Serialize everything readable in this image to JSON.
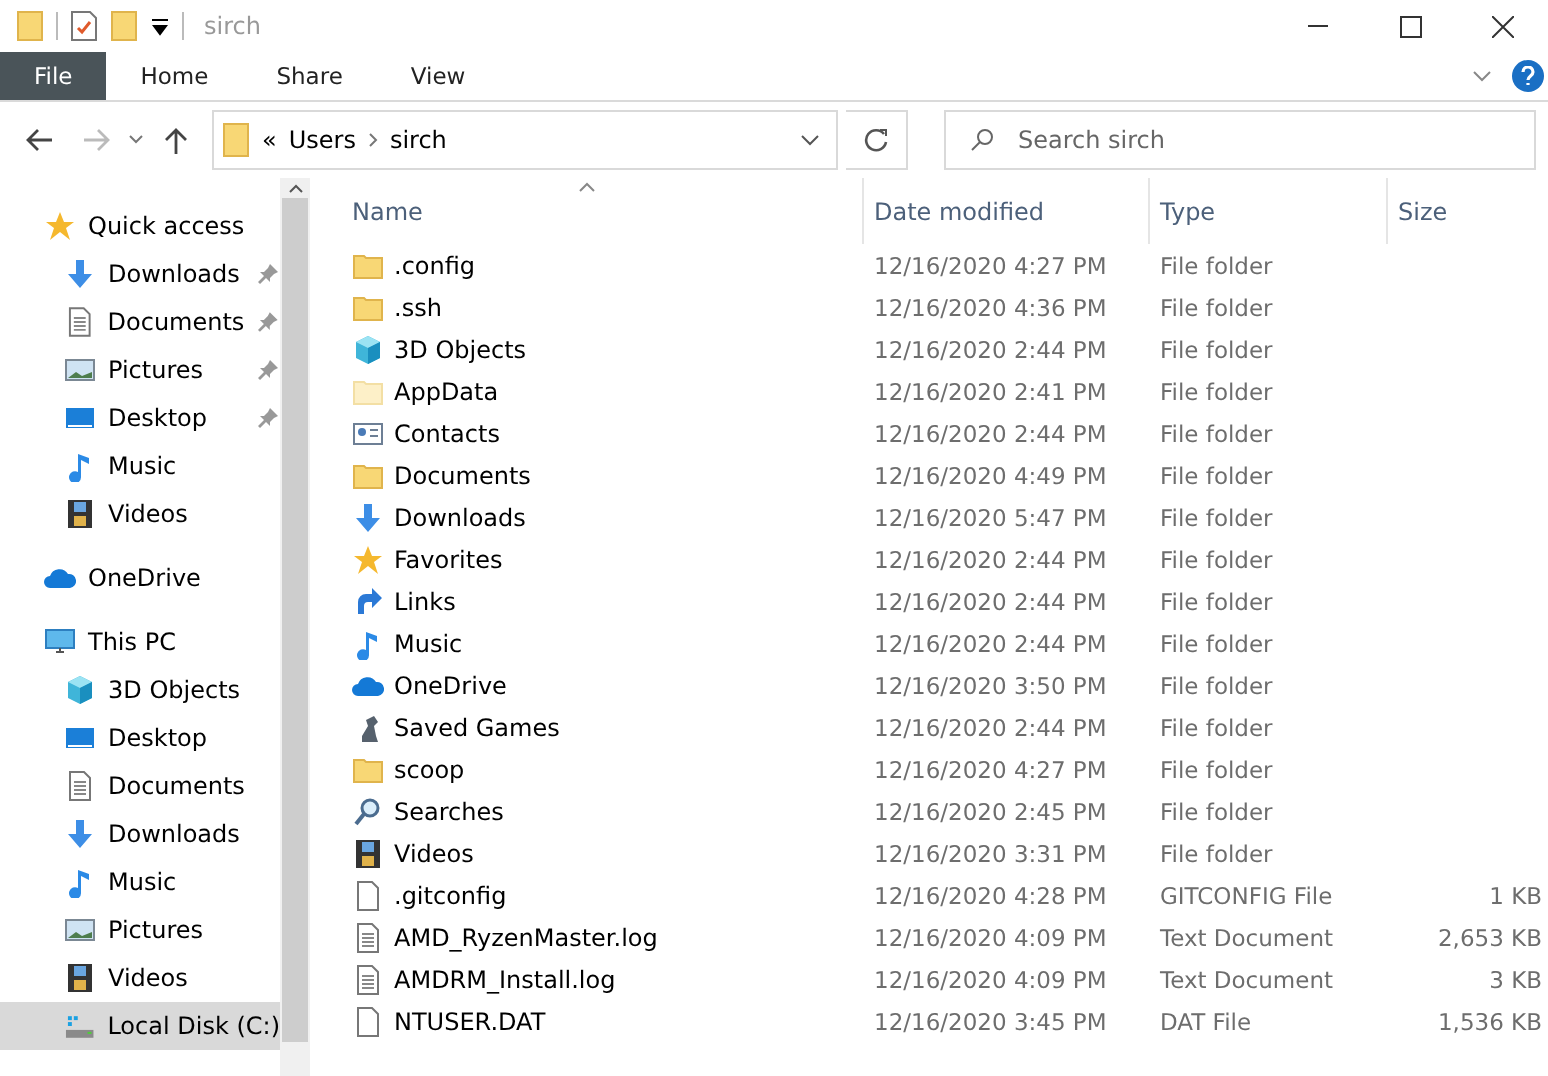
{
  "window": {
    "title": "sirch"
  },
  "ribbon_tabs": [
    {
      "label": "File",
      "selected": true
    },
    {
      "label": "Home",
      "selected": false
    },
    {
      "label": "Share",
      "selected": false
    },
    {
      "label": "View",
      "selected": false
    }
  ],
  "address": {
    "overflow": "«",
    "path": [
      "Users",
      "sirch"
    ]
  },
  "search": {
    "placeholder": "Search sirch"
  },
  "sidebar": {
    "items": [
      {
        "label": "Quick access",
        "kind": "star",
        "selected": false,
        "pinned": false,
        "children": [
          {
            "label": "Downloads",
            "kind": "downloads",
            "selected": false,
            "pinned": true
          },
          {
            "label": "Documents",
            "kind": "documents",
            "selected": false,
            "pinned": true
          },
          {
            "label": "Pictures",
            "kind": "pictures",
            "selected": false,
            "pinned": true
          },
          {
            "label": "Desktop",
            "kind": "desktop",
            "selected": false,
            "pinned": true
          },
          {
            "label": "Music",
            "kind": "music",
            "selected": false,
            "pinned": false
          },
          {
            "label": "Videos",
            "kind": "videos",
            "selected": false,
            "pinned": false
          }
        ]
      },
      {
        "label": "OneDrive",
        "kind": "onedrive",
        "selected": false,
        "pinned": false
      },
      {
        "label": "This PC",
        "kind": "pc",
        "selected": false,
        "pinned": false,
        "children": [
          {
            "label": "3D Objects",
            "kind": "cube",
            "selected": false,
            "pinned": false
          },
          {
            "label": "Desktop",
            "kind": "desktop",
            "selected": false,
            "pinned": false
          },
          {
            "label": "Documents",
            "kind": "documents",
            "selected": false,
            "pinned": false
          },
          {
            "label": "Downloads",
            "kind": "downloads",
            "selected": false,
            "pinned": false
          },
          {
            "label": "Music",
            "kind": "music",
            "selected": false,
            "pinned": false
          },
          {
            "label": "Pictures",
            "kind": "pictures",
            "selected": false,
            "pinned": false
          },
          {
            "label": "Videos",
            "kind": "videos",
            "selected": false,
            "pinned": false
          },
          {
            "label": "Local Disk (C:)",
            "kind": "disk",
            "selected": true,
            "pinned": false
          }
        ]
      }
    ]
  },
  "table": {
    "columns": [
      "Name",
      "Date modified",
      "Type",
      "Size"
    ],
    "rows": [
      {
        "name": ".config",
        "kind": "folder",
        "date": "12/16/2020 4:27 PM",
        "type": "File folder"
      },
      {
        "name": ".ssh",
        "kind": "folder",
        "date": "12/16/2020 4:36 PM",
        "type": "File folder"
      },
      {
        "name": "3D Objects",
        "kind": "cube",
        "date": "12/16/2020 2:44 PM",
        "type": "File folder"
      },
      {
        "name": "AppData",
        "kind": "hidden",
        "date": "12/16/2020 2:41 PM",
        "type": "File folder"
      },
      {
        "name": "Contacts",
        "kind": "contacts",
        "date": "12/16/2020 2:44 PM",
        "type": "File folder"
      },
      {
        "name": "Documents",
        "kind": "folder",
        "date": "12/16/2020 4:49 PM",
        "type": "File folder"
      },
      {
        "name": "Downloads",
        "kind": "downloads",
        "date": "12/16/2020 5:47 PM",
        "type": "File folder"
      },
      {
        "name": "Favorites",
        "kind": "star",
        "date": "12/16/2020 2:44 PM",
        "type": "File folder"
      },
      {
        "name": "Links",
        "kind": "links",
        "date": "12/16/2020 2:44 PM",
        "type": "File folder"
      },
      {
        "name": "Music",
        "kind": "music",
        "date": "12/16/2020 2:44 PM",
        "type": "File folder"
      },
      {
        "name": "OneDrive",
        "kind": "onedrive",
        "date": "12/16/2020 3:50 PM",
        "type": "File folder"
      },
      {
        "name": "Saved Games",
        "kind": "games",
        "date": "12/16/2020 2:44 PM",
        "type": "File folder"
      },
      {
        "name": "scoop",
        "kind": "folder",
        "date": "12/16/2020 4:27 PM",
        "type": "File folder"
      },
      {
        "name": "Searches",
        "kind": "searches",
        "date": "12/16/2020 2:45 PM",
        "type": "File folder"
      },
      {
        "name": "Videos",
        "kind": "videos",
        "date": "12/16/2020 3:31 PM",
        "type": "File folder"
      },
      {
        "name": ".gitconfig",
        "kind": "file",
        "date": "12/16/2020 4:28 PM",
        "type": "GITCONFIG File",
        "size": "1 KB"
      },
      {
        "name": "AMD_RyzenMaster.log",
        "kind": "text",
        "date": "12/16/2020 4:09 PM",
        "type": "Text Document",
        "size": "2,653 KB"
      },
      {
        "name": "AMDRM_Install.log",
        "kind": "text",
        "date": "12/16/2020 4:09 PM",
        "type": "Text Document",
        "size": "3 KB"
      },
      {
        "name": "NTUSER.DAT",
        "kind": "file",
        "date": "12/16/2020 3:45 PM",
        "type": "DAT File",
        "size": "1,536 KB"
      }
    ]
  }
}
